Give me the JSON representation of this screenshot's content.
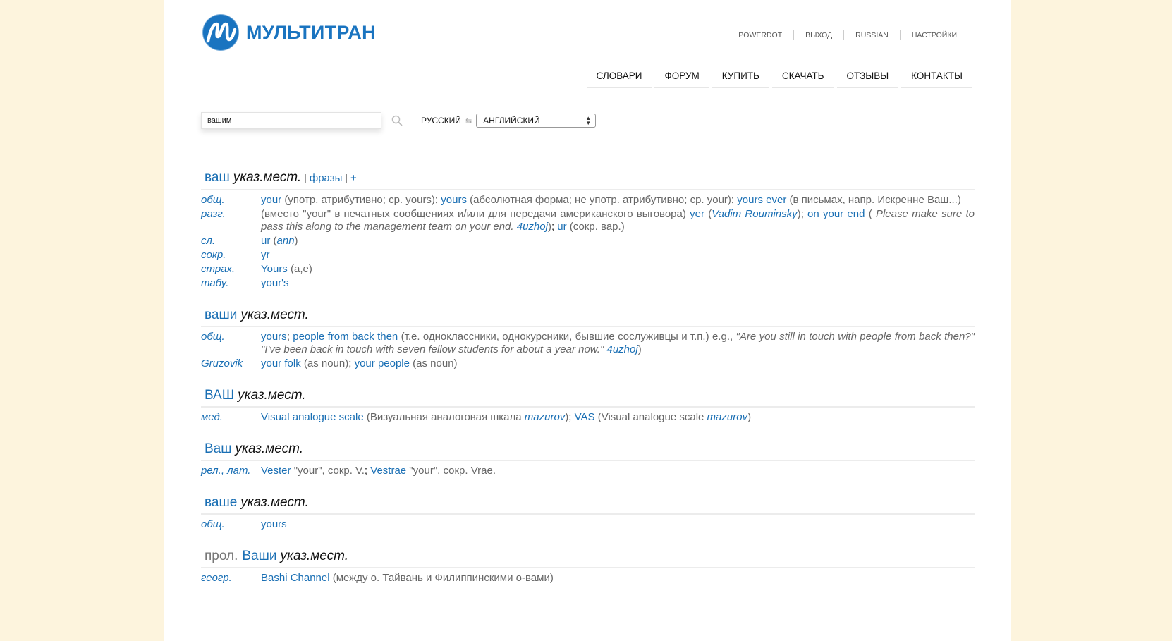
{
  "brand": {
    "name": "МУЛЬТИТРАН"
  },
  "topnav": [
    "POWERDOT",
    "ВЫХОД",
    "RUSSIAN",
    "НАСТРОЙКИ"
  ],
  "mainnav": [
    "СЛОВАРИ",
    "ФОРУМ",
    "КУПИТЬ",
    "СКАЧАТЬ",
    "ОТЗЫВЫ",
    "КОНТАКТЫ"
  ],
  "search": {
    "value": "вашим",
    "lang_from": "РУССКИЙ",
    "lang_to": "АНГЛИЙСКИЙ"
  },
  "entries": [
    {
      "word": "ваш",
      "pos": "указ.мест.",
      "links": [
        "фразы",
        "+"
      ],
      "rows": [
        {
          "subject": "общ.",
          "parts": [
            {
              "k": "t",
              "v": "your"
            },
            {
              "k": "g",
              "v": " (употр. атрибутивно; ср. yours)"
            },
            {
              "k": "p",
              "v": "; "
            },
            {
              "k": "t",
              "v": "yours"
            },
            {
              "k": "g",
              "v": " (абсолютная форма; не употр. атрибутивно; ср. your)"
            },
            {
              "k": "p",
              "v": "; "
            },
            {
              "k": "t",
              "v": "yours ever"
            },
            {
              "k": "g",
              "v": " (в письмах, напр. Искренне Ваш...)"
            }
          ]
        },
        {
          "subject": "разг.",
          "parts": [
            {
              "k": "g",
              "v": "(вместо \"your\" в печатных сообщениях и/или для передачи американского выговора) "
            },
            {
              "k": "t",
              "v": "yer"
            },
            {
              "k": "g",
              "v": " ("
            },
            {
              "k": "a",
              "v": "Vadim Rouminsky"
            },
            {
              "k": "g",
              "v": ")"
            },
            {
              "k": "p",
              "v": "; "
            },
            {
              "k": "t",
              "v": "on your end"
            },
            {
              "k": "g",
              "v": " ( "
            },
            {
              "k": "ex",
              "v": "Please make sure to pass this along to the management team on your end. "
            },
            {
              "k": "a",
              "v": " 4uzhoj"
            },
            {
              "k": "g",
              "v": ")"
            },
            {
              "k": "p",
              "v": "; "
            },
            {
              "k": "t",
              "v": "ur"
            },
            {
              "k": "g",
              "v": " (сокр. вар.)"
            }
          ]
        },
        {
          "subject": "сл.",
          "parts": [
            {
              "k": "t",
              "v": "ur"
            },
            {
              "k": "g",
              "v": " ("
            },
            {
              "k": "a",
              "v": "ann"
            },
            {
              "k": "g",
              "v": ")"
            }
          ]
        },
        {
          "subject": "сокр.",
          "parts": [
            {
              "k": "t",
              "v": "yr"
            }
          ]
        },
        {
          "subject": "страх.",
          "parts": [
            {
              "k": "t",
              "v": "Yours"
            },
            {
              "k": "g",
              "v": " (a,e)"
            }
          ]
        },
        {
          "subject": "табу.",
          "parts": [
            {
              "k": "t",
              "v": "your's"
            }
          ]
        }
      ]
    },
    {
      "word": "ваши",
      "pos": "указ.мест.",
      "rows": [
        {
          "subject": "общ.",
          "parts": [
            {
              "k": "t",
              "v": "yours"
            },
            {
              "k": "p",
              "v": "; "
            },
            {
              "k": "t",
              "v": "people from back then"
            },
            {
              "k": "g",
              "v": " (т.е. одноклассники, однокурсники, бывшие сослуживцы и т.п.) e.g., "
            },
            {
              "k": "ex",
              "v": "\"Are you still in touch with people from back then?\" \"I've been back in touch with seven fellow students for about a year now.\""
            },
            {
              "k": "a",
              "v": " 4uzhoj"
            },
            {
              "k": "g",
              "v": ")"
            }
          ]
        },
        {
          "subject": "Gruzovik",
          "parts": [
            {
              "k": "t",
              "v": "your folk"
            },
            {
              "k": "g",
              "v": " (as noun)"
            },
            {
              "k": "p",
              "v": "; "
            },
            {
              "k": "t",
              "v": "your people"
            },
            {
              "k": "g",
              "v": " (as noun)"
            }
          ]
        }
      ]
    },
    {
      "word": "ВАШ",
      "pos": "указ.мест.",
      "rows": [
        {
          "subject": "мед.",
          "parts": [
            {
              "k": "t",
              "v": "Visual analogue scale"
            },
            {
              "k": "g",
              "v": " (Визуальная аналоговая шкала "
            },
            {
              "k": "a",
              "v": "mazurov"
            },
            {
              "k": "g",
              "v": ")"
            },
            {
              "k": "p",
              "v": "; "
            },
            {
              "k": "t",
              "v": "VAS"
            },
            {
              "k": "g",
              "v": " (Visual analogue scale "
            },
            {
              "k": "a",
              "v": "mazurov"
            },
            {
              "k": "g",
              "v": ")"
            }
          ]
        }
      ]
    },
    {
      "word": "Ваш",
      "pos": "указ.мест.",
      "rows": [
        {
          "subject": "рел., лат.",
          "parts": [
            {
              "k": "t",
              "v": "Vester"
            },
            {
              "k": "g",
              "v": " \"your\", сокр. V."
            },
            {
              "k": "p",
              "v": "; "
            },
            {
              "k": "t",
              "v": "Vestrae"
            },
            {
              "k": "g",
              "v": " \"your\", сокр. Vrae."
            }
          ]
        }
      ]
    },
    {
      "word": "ваше",
      "pos": "указ.мест.",
      "rows": [
        {
          "subject": "общ.",
          "parts": [
            {
              "k": "t",
              "v": "yours"
            }
          ]
        }
      ]
    },
    {
      "prefix": "прол.",
      "word": "Ваши",
      "pos": "указ.мест.",
      "rows": [
        {
          "subject": "геогр.",
          "parts": [
            {
              "k": "t",
              "v": "Bashi Channel"
            },
            {
              "k": "g",
              "v": " (между о. Тайвань и Филиппинскими о-вами)"
            }
          ]
        }
      ]
    }
  ]
}
